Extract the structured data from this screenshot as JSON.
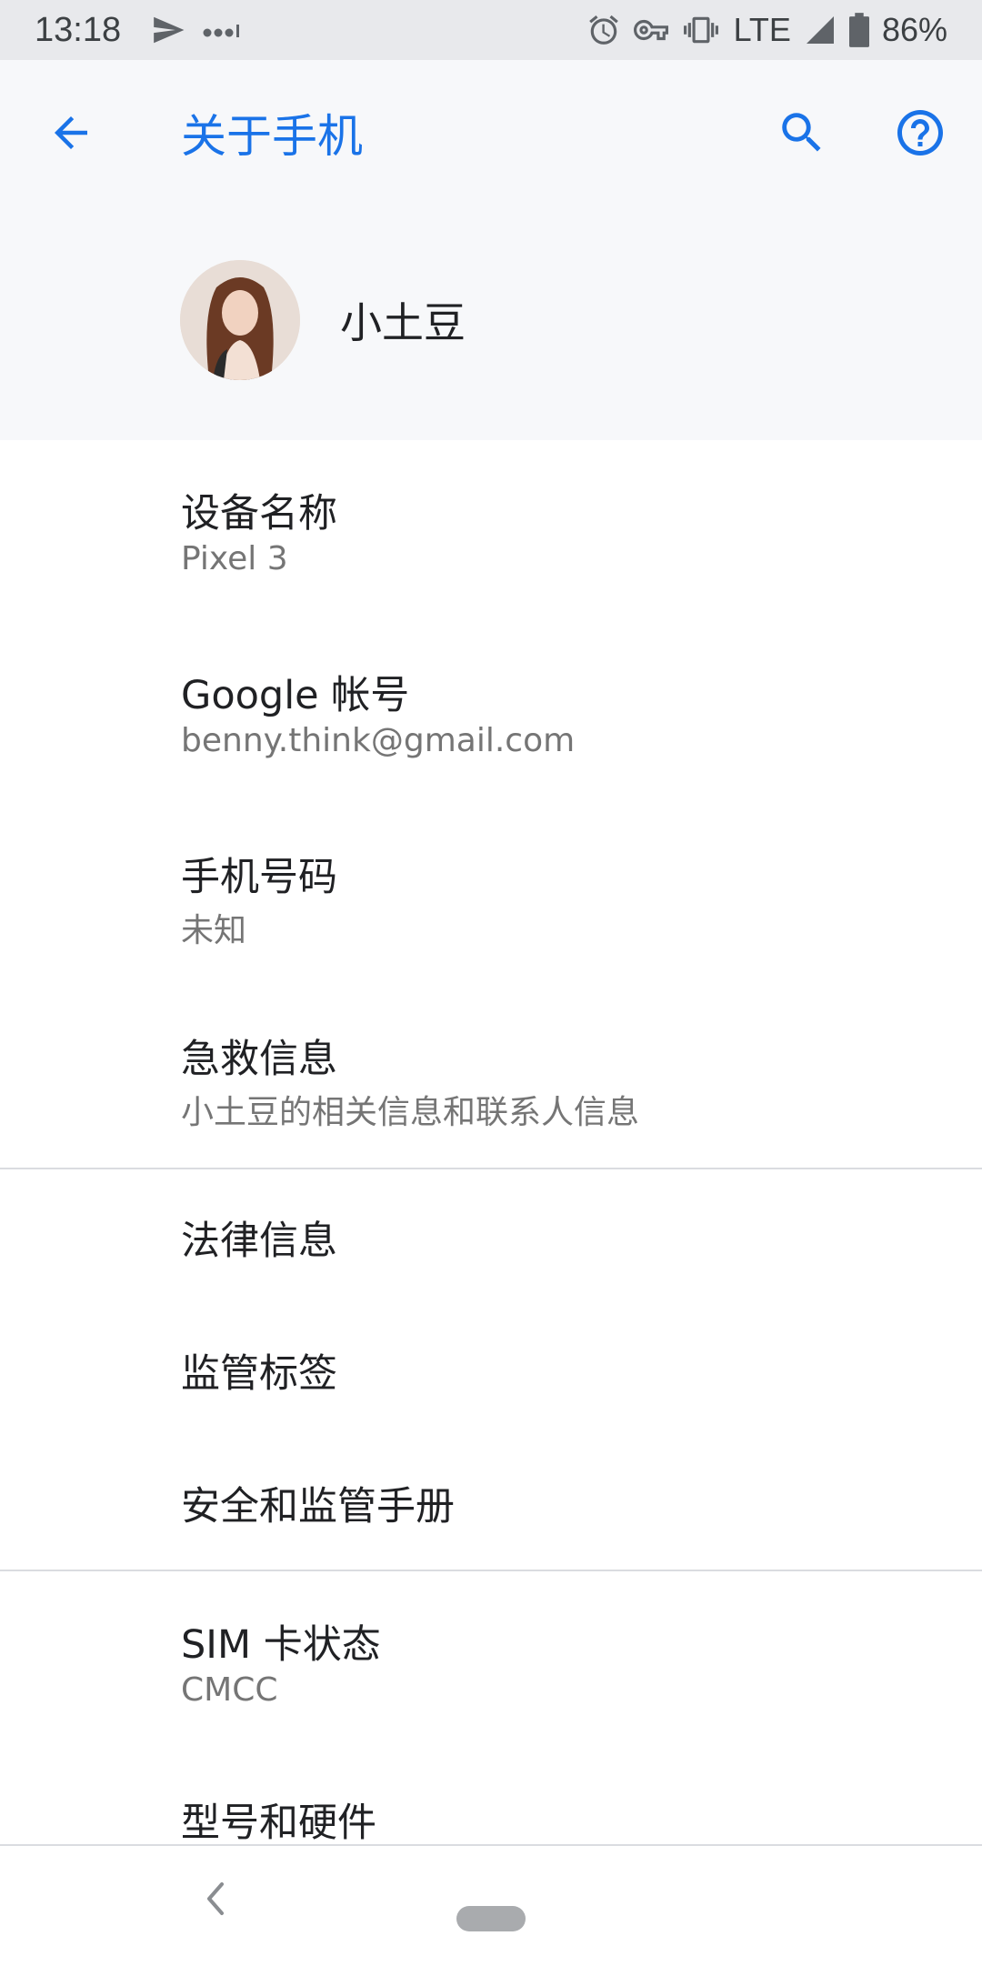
{
  "status_bar": {
    "time": "13:18",
    "network": "LTE",
    "battery": "86%",
    "icons": [
      "send-icon",
      "more-dots-icon",
      "alarm-icon",
      "vpn-key-icon",
      "vibrate-icon",
      "signal-icon",
      "battery-icon"
    ]
  },
  "header": {
    "title": "关于手机",
    "icons": [
      "back-arrow-icon",
      "search-icon",
      "help-icon"
    ],
    "accent_color": "#1a73e8"
  },
  "profile": {
    "name": "小土豆"
  },
  "items": [
    {
      "title": "设备名称",
      "subtitle": "Pixel 3"
    },
    {
      "title": "Google 帐号",
      "subtitle": "benny.think@gmail.com"
    },
    {
      "title": "手机号码",
      "subtitle": "未知"
    },
    {
      "title": "急救信息",
      "subtitle": "小土豆的相关信息和联系人信息"
    },
    {
      "title": "法律信息"
    },
    {
      "title": "监管标签"
    },
    {
      "title": "安全和监管手册"
    },
    {
      "title": "SIM 卡状态",
      "subtitle": "CMCC"
    },
    {
      "title": "型号和硬件"
    }
  ],
  "nav_bar": {
    "icons": [
      "nav-back-icon",
      "home-pill-icon"
    ]
  }
}
